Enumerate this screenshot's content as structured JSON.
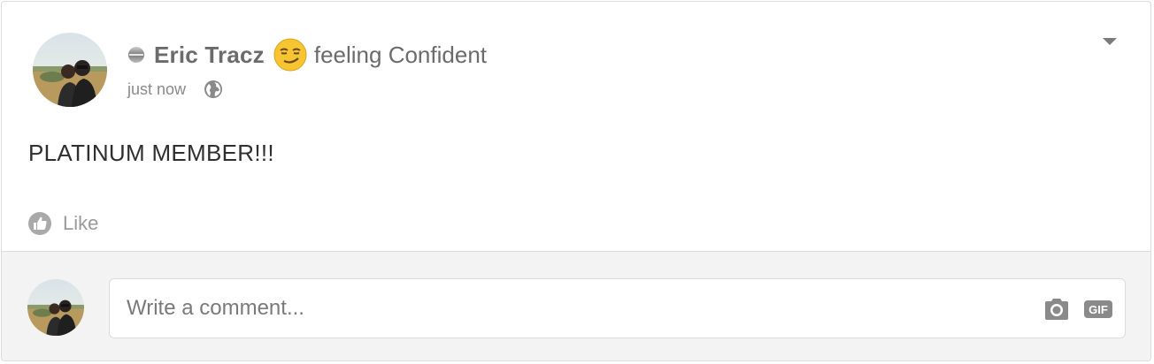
{
  "post": {
    "author": "Eric Tracz",
    "feeling_text": "feeling Confident",
    "feeling_emoji": "smirking-face-emoji",
    "timestamp": "just now",
    "privacy_icon": "globe-icon",
    "body": "PLATINUM MEMBER!!!",
    "like_label": "Like"
  },
  "comment": {
    "placeholder": "Write a comment...",
    "camera_icon": "camera-icon",
    "gif_label": "GIF"
  },
  "colors": {
    "text_muted": "#6b6b6b",
    "comment_bg": "#f3f3f3",
    "border": "#dcdcdc"
  }
}
